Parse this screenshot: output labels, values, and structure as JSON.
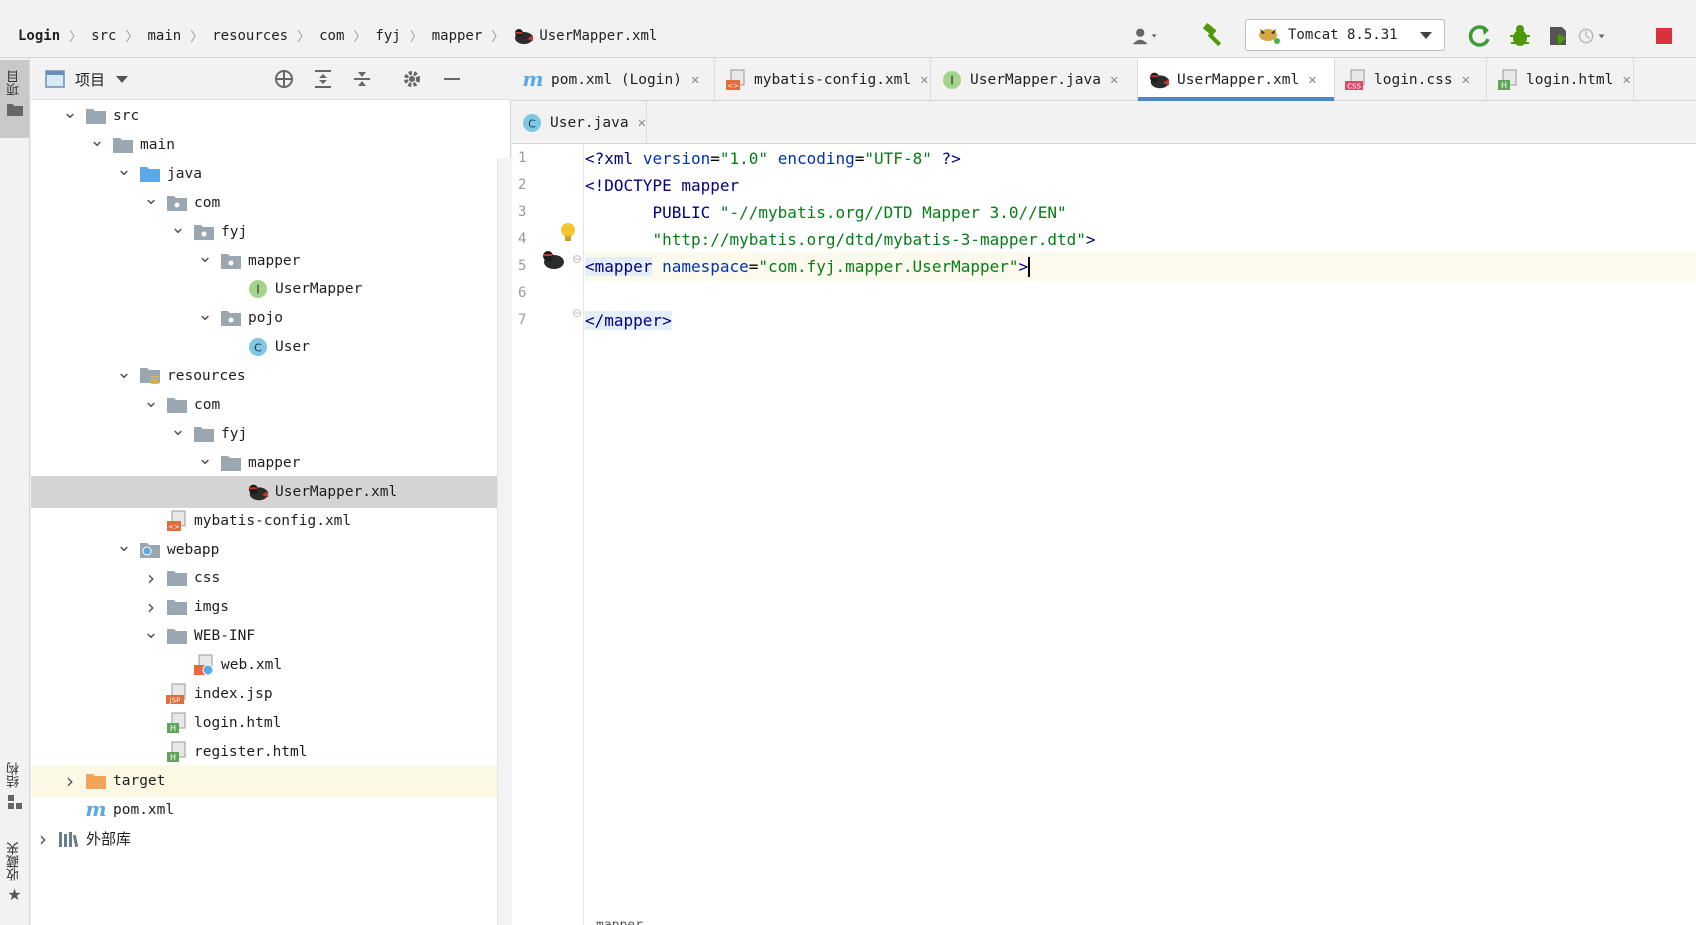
{
  "navbar": {
    "breadcrumb": [
      "Login",
      "src",
      "main",
      "resources",
      "com",
      "fyj",
      "mapper",
      "UserMapper.xml"
    ],
    "run_config": "Tomcat 8.5.31"
  },
  "left_stripe": {
    "project": "项目",
    "structure": "结构",
    "favorites": "收藏夹"
  },
  "project_panel": {
    "title": "项目"
  },
  "tree": [
    {
      "label": "src",
      "icon": "folder-icon",
      "depth": 0,
      "chevron": "down"
    },
    {
      "label": "main",
      "icon": "folder-icon",
      "depth": 1,
      "chevron": "down"
    },
    {
      "label": "java",
      "icon": "source-folder-icon",
      "depth": 2,
      "chevron": "down"
    },
    {
      "label": "com",
      "icon": "package-icon",
      "depth": 3,
      "chevron": "down"
    },
    {
      "label": "fyj",
      "icon": "package-icon",
      "depth": 4,
      "chevron": "down"
    },
    {
      "label": "mapper",
      "icon": "package-icon",
      "depth": 5,
      "chevron": "down"
    },
    {
      "label": "UserMapper",
      "icon": "interface-icon",
      "depth": 6,
      "chevron": ""
    },
    {
      "label": "pojo",
      "icon": "package-icon",
      "depth": 5,
      "chevron": "down"
    },
    {
      "label": "User",
      "icon": "class-icon",
      "depth": 6,
      "chevron": ""
    },
    {
      "label": "resources",
      "icon": "resources-folder-icon",
      "depth": 2,
      "chevron": "down"
    },
    {
      "label": "com",
      "icon": "folder-icon",
      "depth": 3,
      "chevron": "down"
    },
    {
      "label": "fyj",
      "icon": "folder-icon",
      "depth": 4,
      "chevron": "down"
    },
    {
      "label": "mapper",
      "icon": "folder-icon",
      "depth": 5,
      "chevron": "down"
    },
    {
      "label": "UserMapper.xml",
      "icon": "mybatis-icon",
      "depth": 6,
      "chevron": "",
      "selected": true
    },
    {
      "label": "mybatis-config.xml",
      "icon": "xml-file-icon",
      "depth": 3,
      "chevron": ""
    },
    {
      "label": "webapp",
      "icon": "web-folder-icon",
      "depth": 2,
      "chevron": "down"
    },
    {
      "label": "css",
      "icon": "folder-icon",
      "depth": 3,
      "chevron": "right"
    },
    {
      "label": "imgs",
      "icon": "folder-icon",
      "depth": 3,
      "chevron": "right"
    },
    {
      "label": "WEB-INF",
      "icon": "folder-icon",
      "depth": 3,
      "chevron": "down"
    },
    {
      "label": "web.xml",
      "icon": "web-xml-icon",
      "depth": 4,
      "chevron": ""
    },
    {
      "label": "index.jsp",
      "icon": "jsp-file-icon",
      "depth": 3,
      "chevron": ""
    },
    {
      "label": "login.html",
      "icon": "html-file-icon",
      "depth": 3,
      "chevron": ""
    },
    {
      "label": "register.html",
      "icon": "html-file-icon",
      "depth": 3,
      "chevron": ""
    },
    {
      "label": "target",
      "icon": "excluded-folder-icon",
      "depth": 0,
      "chevron": "right",
      "highlight": true
    },
    {
      "label": "pom.xml",
      "icon": "maven-icon",
      "depth": 0,
      "chevron": ""
    },
    {
      "label": "外部库",
      "icon": "library-icon",
      "depth": -1,
      "chevron": "right",
      "cjk": true
    }
  ],
  "tabs_row1": [
    {
      "label": "pom.xml (Login)",
      "icon": "maven-icon"
    },
    {
      "label": "mybatis-config.xml",
      "icon": "xml-file-icon"
    },
    {
      "label": "UserMapper.java",
      "icon": "interface-icon"
    },
    {
      "label": "UserMapper.xml",
      "icon": "mybatis-icon",
      "active": true
    },
    {
      "label": "login.css",
      "icon": "css-file-icon"
    },
    {
      "label": "login.html",
      "icon": "html-file-icon"
    }
  ],
  "tabs_row2": [
    {
      "label": "User.java",
      "icon": "class-icon"
    }
  ],
  "editor": {
    "line_numbers": [
      "1",
      "2",
      "3",
      "4",
      "5",
      "6",
      "7"
    ],
    "status_breadcrumb": "mapper",
    "lines": {
      "l1": {
        "open": "<?",
        "tag": "xml",
        "a1": "version",
        "eq1": "=",
        "v1": "\"1.0\"",
        "a2": "encoding",
        "eq2": "=",
        "v2": "\"UTF-8\"",
        "close": "?>"
      },
      "l2": {
        "text": "<!DOCTYPE mapper"
      },
      "l3": {
        "indent": "       ",
        "kw": "PUBLIC",
        "str": "\"-//mybatis.org//DTD Mapper 3.0//EN\""
      },
      "l4": {
        "indent": "       ",
        "str": "\"http://mybatis.org/dtd/mybatis-3-mapper.dtd\"",
        "close": ">"
      },
      "l5": {
        "open": "<mapper",
        "attr": "namespace",
        "eq": "=",
        "val": "\"com.fyj.mapper.UserMapper\"",
        "close": ">"
      },
      "l7": {
        "text": "</mapper>"
      }
    }
  }
}
